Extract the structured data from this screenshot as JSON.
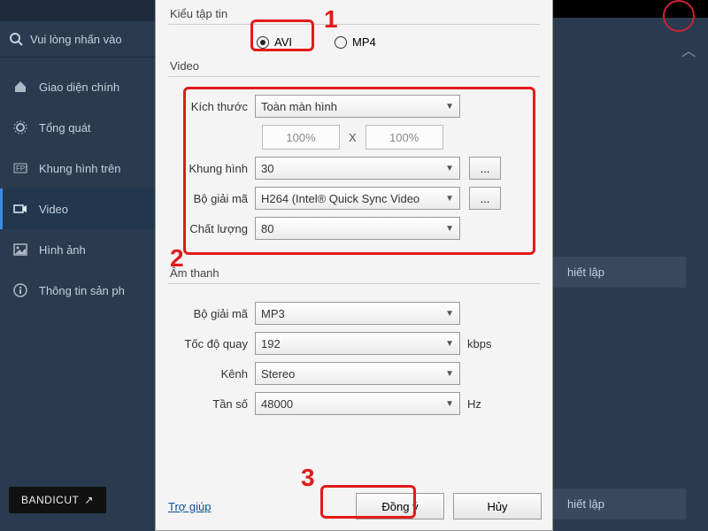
{
  "sidebar": {
    "search_prompt": "Vui lòng nhấn vào",
    "items": [
      {
        "label": "Giao diện chính"
      },
      {
        "label": "Tổng quát"
      },
      {
        "label": "Khung hình trên"
      },
      {
        "label": "Video"
      },
      {
        "label": "Hình ảnh"
      },
      {
        "label": "Thông tin sản ph"
      }
    ],
    "bandicut": "BANDICUT"
  },
  "markers": {
    "m1": "1",
    "m2": "2",
    "m3": "3"
  },
  "right": {
    "hiet_lap": "hiết lập"
  },
  "dialog": {
    "file_type": {
      "label": "Kiểu tập tin",
      "options": {
        "avi": "AVI",
        "mp4": "MP4"
      },
      "selected": "AVI"
    },
    "video": {
      "title": "Video",
      "size_label": "Kích thước",
      "size_value": "Toàn màn hình",
      "width_pct": "100%",
      "height_pct": "100%",
      "x": "X",
      "fps_label": "Khung hình",
      "fps_value": "30",
      "codec_label": "Bộ giải mã",
      "codec_value": "H264 (Intel® Quick Sync Video",
      "quality_label": "Chất lượng",
      "quality_value": "80",
      "dots": "..."
    },
    "audio": {
      "title": "Âm thanh",
      "codec_label": "Bộ giải mã",
      "codec_value": "MP3",
      "bitrate_label": "Tốc độ quay",
      "bitrate_value": "192",
      "bitrate_unit": "kbps",
      "channel_label": "Kênh",
      "channel_value": "Stereo",
      "freq_label": "Tần số",
      "freq_value": "48000",
      "freq_unit": "Hz"
    },
    "help": "Trợ giúp",
    "ok": "Đồng ý",
    "cancel": "Hủy"
  }
}
